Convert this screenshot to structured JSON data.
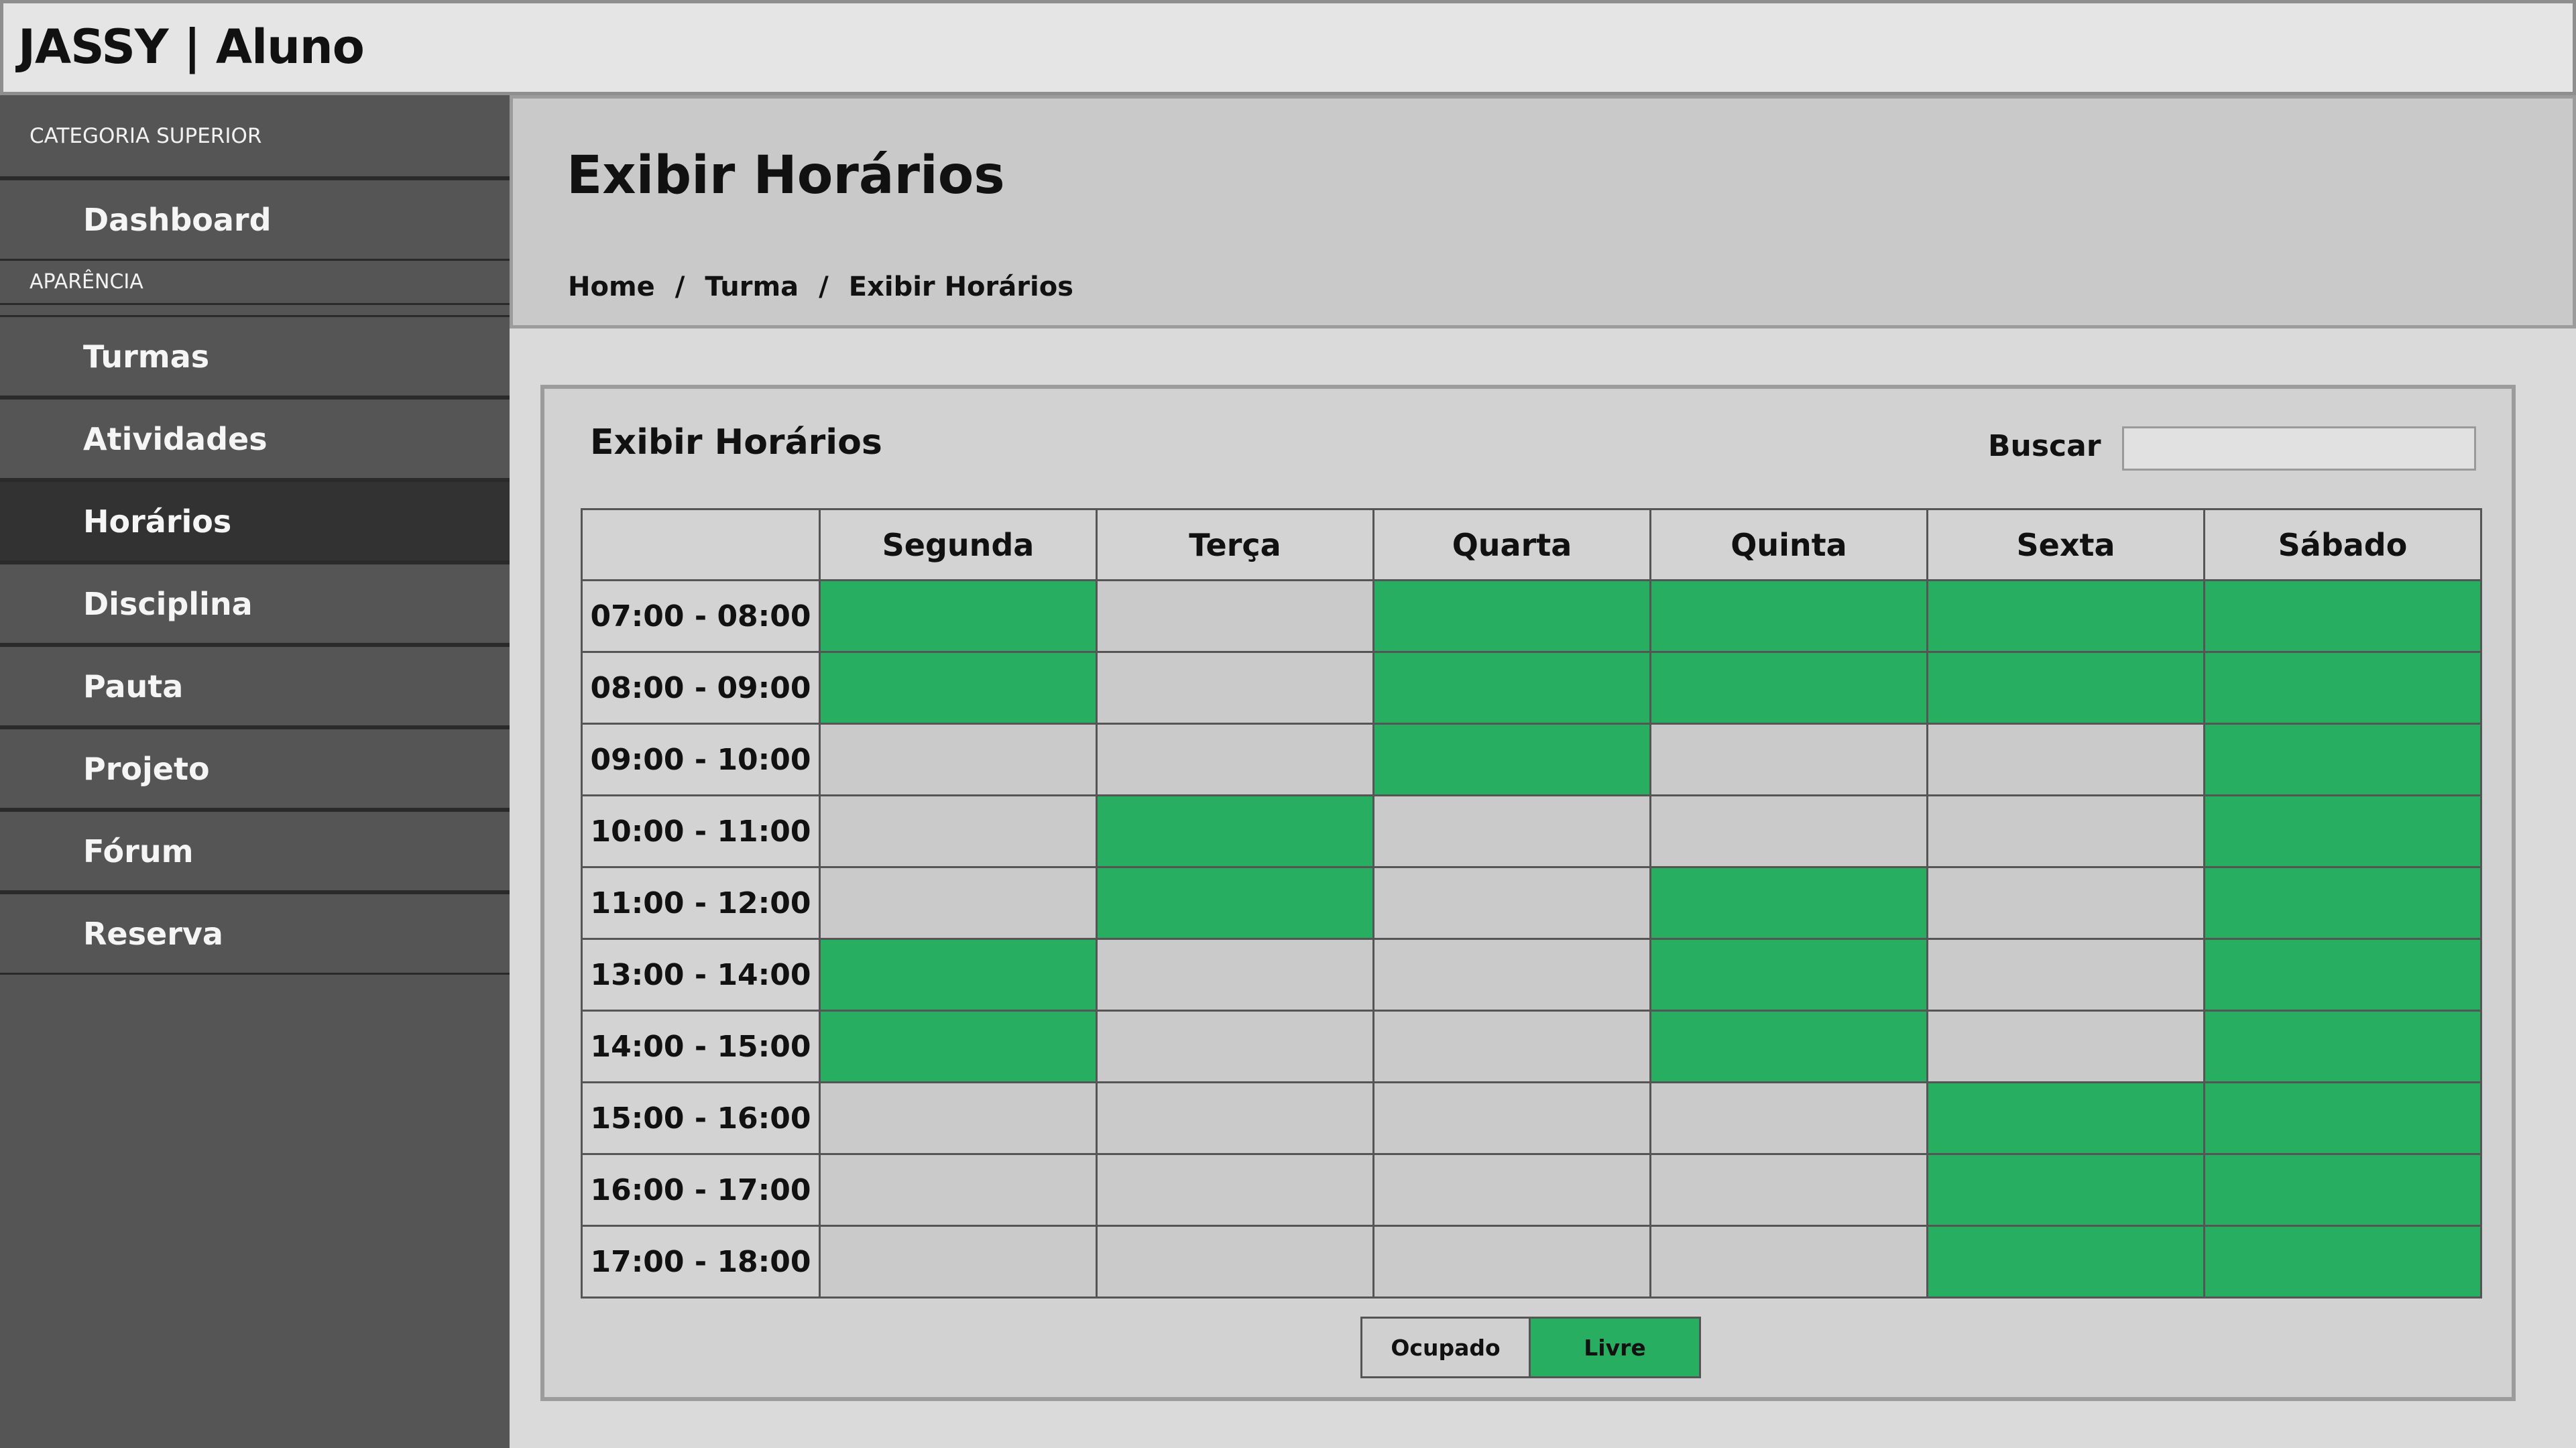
{
  "app": {
    "title": "JASSY | Aluno"
  },
  "sidebar": {
    "headers": [
      "CATEGORIA SUPERIOR",
      "APARÊNCIA"
    ],
    "items": [
      {
        "label": "Dashboard",
        "active": false
      },
      {
        "label": "Turmas",
        "active": false
      },
      {
        "label": "Atividades",
        "active": false
      },
      {
        "label": "Horários",
        "active": true
      },
      {
        "label": "Disciplina",
        "active": false
      },
      {
        "label": "Pauta",
        "active": false
      },
      {
        "label": "Projeto",
        "active": false
      },
      {
        "label": "Fórum",
        "active": false
      },
      {
        "label": "Reserva",
        "active": false
      }
    ]
  },
  "header": {
    "title": "Exibir Horários",
    "breadcrumb": [
      "Home",
      "Turma",
      "Exibir Horários"
    ],
    "separator": "/"
  },
  "card": {
    "title": "Exibir Horários",
    "search_label": "Buscar",
    "search_value": "",
    "search_placeholder": ""
  },
  "schedule": {
    "days": [
      "Segunda",
      "Terça",
      "Quarta",
      "Quinta",
      "Sexta",
      "Sábado"
    ],
    "slots": [
      {
        "time": "07:00 - 08:00",
        "cells": [
          "livre",
          "ocupado",
          "livre",
          "livre",
          "livre",
          "livre"
        ]
      },
      {
        "time": "08:00 - 09:00",
        "cells": [
          "livre",
          "ocupado",
          "livre",
          "livre",
          "livre",
          "livre"
        ]
      },
      {
        "time": "09:00 - 10:00",
        "cells": [
          "ocupado",
          "ocupado",
          "livre",
          "ocupado",
          "ocupado",
          "livre"
        ]
      },
      {
        "time": "10:00 - 11:00",
        "cells": [
          "ocupado",
          "livre",
          "ocupado",
          "ocupado",
          "ocupado",
          "livre"
        ]
      },
      {
        "time": "11:00 - 12:00",
        "cells": [
          "ocupado",
          "livre",
          "ocupado",
          "livre",
          "ocupado",
          "livre"
        ]
      },
      {
        "time": "13:00 - 14:00",
        "cells": [
          "livre",
          "ocupado",
          "ocupado",
          "livre",
          "ocupado",
          "livre"
        ]
      },
      {
        "time": "14:00 - 15:00",
        "cells": [
          "livre",
          "ocupado",
          "ocupado",
          "livre",
          "ocupado",
          "livre"
        ]
      },
      {
        "time": "15:00 - 16:00",
        "cells": [
          "ocupado",
          "ocupado",
          "ocupado",
          "ocupado",
          "livre",
          "livre"
        ]
      },
      {
        "time": "16:00 - 17:00",
        "cells": [
          "ocupado",
          "ocupado",
          "ocupado",
          "ocupado",
          "livre",
          "livre"
        ]
      },
      {
        "time": "17:00 - 18:00",
        "cells": [
          "ocupado",
          "ocupado",
          "ocupado",
          "ocupado",
          "livre",
          "livre"
        ]
      }
    ]
  },
  "legend": {
    "busy_label": "Ocupado",
    "free_label": "Livre"
  },
  "colors": {
    "free": "#27ae60",
    "busy": "#cacaca",
    "sidebar_bg": "#555555",
    "sidebar_active": "#323232"
  }
}
